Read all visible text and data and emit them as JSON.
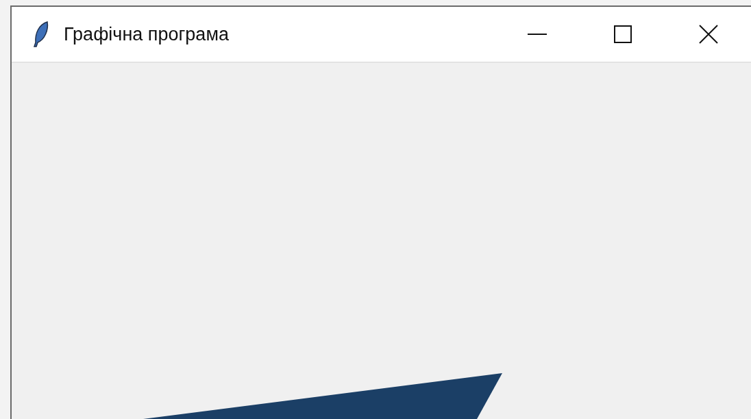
{
  "window": {
    "title": "Графічна програма"
  },
  "canvas": {
    "shapes": [
      {
        "kind": "polygon",
        "color": "#1b3f66"
      }
    ]
  }
}
